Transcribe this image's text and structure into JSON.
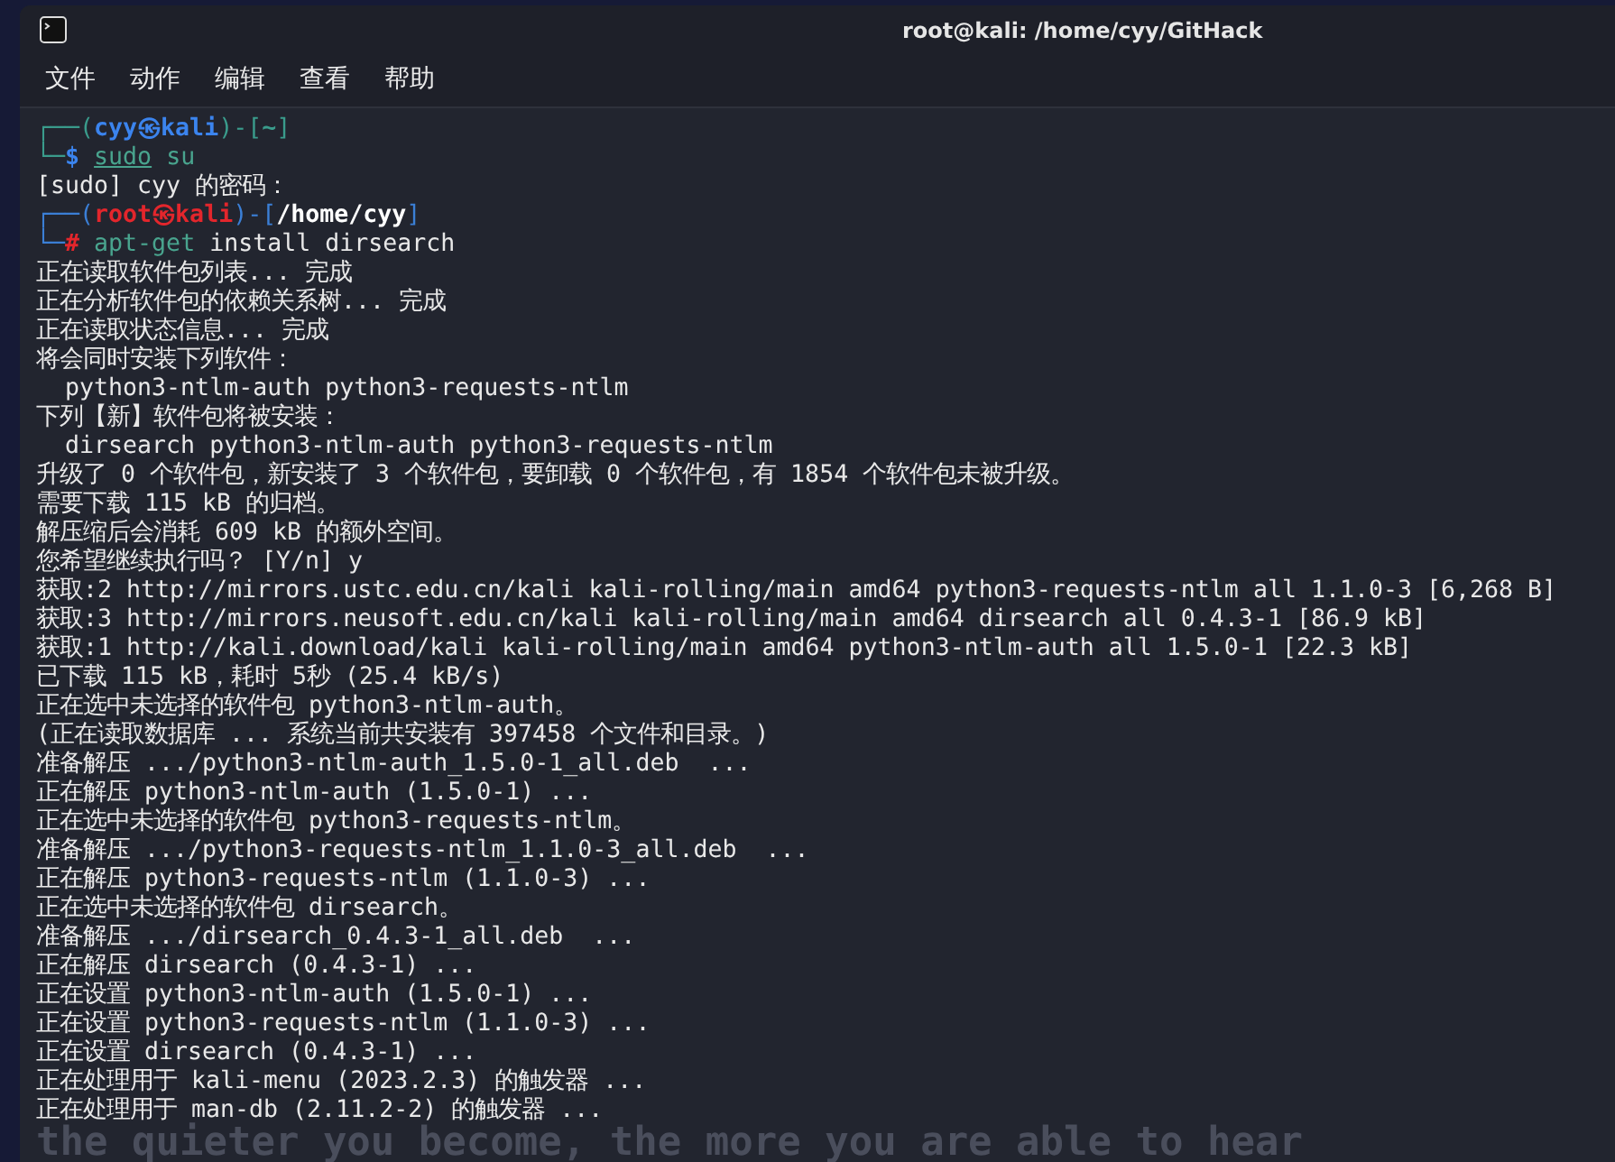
{
  "window": {
    "title": "root@kali: /home/cyy/GitHack"
  },
  "menu": [
    {
      "label": "文件"
    },
    {
      "label": "动作"
    },
    {
      "label": "编辑"
    },
    {
      "label": "查看"
    },
    {
      "label": "帮助"
    }
  ],
  "terminal": {
    "lines": [
      {
        "kind": "prompt",
        "segments": [
          {
            "text": "┌──(",
            "kind": "frameteal"
          },
          {
            "text": "cyy㉿kali",
            "kind": "nameblue"
          },
          {
            "text": ")-[",
            "kind": "frameteal"
          },
          {
            "text": "~",
            "kind": "pathteal"
          },
          {
            "text": "]",
            "kind": "frameteal"
          }
        ]
      },
      {
        "kind": "command",
        "segments": [
          {
            "text": "└─",
            "kind": "frameteal"
          },
          {
            "text": "$ ",
            "kind": "signblue"
          },
          {
            "text": "sudo",
            "kind": "cmdunderline"
          },
          {
            "text": " su",
            "kind": "cmd"
          }
        ]
      },
      {
        "kind": "output",
        "text": "[sudo] cyy 的密码："
      },
      {
        "kind": "prompt",
        "segments": [
          {
            "text": "┌──(",
            "kind": "frameblue"
          },
          {
            "text": "root㉿kali",
            "kind": "namered"
          },
          {
            "text": ")-[",
            "kind": "frameblue"
          },
          {
            "text": "/home/cyy",
            "kind": "pathwhite"
          },
          {
            "text": "]",
            "kind": "frameblue"
          }
        ]
      },
      {
        "kind": "command",
        "segments": [
          {
            "text": "└─",
            "kind": "frameblue"
          },
          {
            "text": "# ",
            "kind": "signred"
          },
          {
            "text": "apt-get",
            "kind": "cmd"
          },
          {
            "text": " install dirsearch",
            "kind": "arg"
          }
        ]
      },
      {
        "kind": "output",
        "text": "正在读取软件包列表... 完成"
      },
      {
        "kind": "output",
        "text": "正在分析软件包的依赖关系树... 完成"
      },
      {
        "kind": "output",
        "text": "正在读取状态信息... 完成"
      },
      {
        "kind": "output",
        "text": "将会同时安装下列软件："
      },
      {
        "kind": "output",
        "text": "  python3-ntlm-auth python3-requests-ntlm"
      },
      {
        "kind": "output",
        "text": "下列【新】软件包将被安装："
      },
      {
        "kind": "output",
        "text": "  dirsearch python3-ntlm-auth python3-requests-ntlm"
      },
      {
        "kind": "output",
        "text": "升级了 0 个软件包，新安装了 3 个软件包，要卸载 0 个软件包，有 1854 个软件包未被升级。"
      },
      {
        "kind": "output",
        "text": "需要下载 115 kB 的归档。"
      },
      {
        "kind": "output",
        "text": "解压缩后会消耗 609 kB 的额外空间。"
      },
      {
        "kind": "output",
        "text": "您希望继续执行吗？ [Y/n] y"
      },
      {
        "kind": "output",
        "text": "获取:2 http://mirrors.ustc.edu.cn/kali kali-rolling/main amd64 python3-requests-ntlm all 1.1.0-3 [6,268 B]"
      },
      {
        "kind": "output",
        "text": "获取:3 http://mirrors.neusoft.edu.cn/kali kali-rolling/main amd64 dirsearch all 0.4.3-1 [86.9 kB]"
      },
      {
        "kind": "output",
        "text": "获取:1 http://kali.download/kali kali-rolling/main amd64 python3-ntlm-auth all 1.5.0-1 [22.3 kB]"
      },
      {
        "kind": "output",
        "text": "已下载 115 kB，耗时 5秒 (25.4 kB/s)"
      },
      {
        "kind": "output",
        "text": "正在选中未选择的软件包 python3-ntlm-auth。"
      },
      {
        "kind": "output",
        "text": "(正在读取数据库 ... 系统当前共安装有 397458 个文件和目录。)"
      },
      {
        "kind": "output",
        "text": "准备解压 .../python3-ntlm-auth_1.5.0-1_all.deb  ..."
      },
      {
        "kind": "output",
        "text": "正在解压 python3-ntlm-auth (1.5.0-1) ..."
      },
      {
        "kind": "output",
        "text": "正在选中未选择的软件包 python3-requests-ntlm。"
      },
      {
        "kind": "output",
        "text": "准备解压 .../python3-requests-ntlm_1.1.0-3_all.deb  ..."
      },
      {
        "kind": "output",
        "text": "正在解压 python3-requests-ntlm (1.1.0-3) ..."
      },
      {
        "kind": "output",
        "text": "正在选中未选择的软件包 dirsearch。"
      },
      {
        "kind": "output",
        "text": "准备解压 .../dirsearch_0.4.3-1_all.deb  ..."
      },
      {
        "kind": "output",
        "text": "正在解压 dirsearch (0.4.3-1) ..."
      },
      {
        "kind": "output",
        "text": "正在设置 python3-ntlm-auth (1.5.0-1) ..."
      },
      {
        "kind": "output",
        "text": "正在设置 python3-requests-ntlm (1.1.0-3) ..."
      },
      {
        "kind": "output",
        "text": "正在设置 dirsearch (0.4.3-1) ..."
      },
      {
        "kind": "output",
        "text": "正在处理用于 kali-menu (2023.2.3) 的触发器 ..."
      },
      {
        "kind": "output",
        "text": "正在处理用于 man-db (2.11.2-2) 的触发器 ..."
      }
    ]
  },
  "wallpaper": {
    "motto": "the quieter you become, the more you are able to hear"
  }
}
